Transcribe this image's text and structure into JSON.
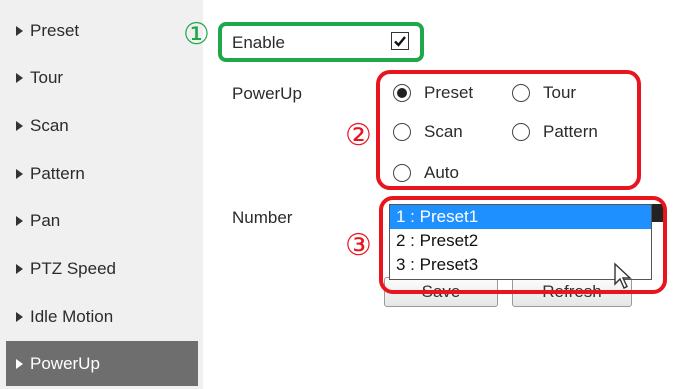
{
  "sidebar": {
    "items": [
      {
        "label": "Preset"
      },
      {
        "label": "Tour"
      },
      {
        "label": "Scan"
      },
      {
        "label": "Pattern"
      },
      {
        "label": "Pan"
      },
      {
        "label": "PTZ Speed"
      },
      {
        "label": "Idle Motion"
      },
      {
        "label": "PowerUp"
      }
    ],
    "active": "PowerUp"
  },
  "form": {
    "enable_label": "Enable",
    "enable_checked": true,
    "powerup_label": "PowerUp",
    "powerup_options": [
      {
        "label": "Preset",
        "selected": true
      },
      {
        "label": "Tour",
        "selected": false
      },
      {
        "label": "Scan",
        "selected": false
      },
      {
        "label": "Pattern",
        "selected": false
      },
      {
        "label": "Auto",
        "selected": false
      }
    ],
    "number_label": "Number",
    "number_options": [
      "1 : Preset1",
      "2 : Preset2",
      "3 : Preset3"
    ],
    "number_selected": "1 : Preset1"
  },
  "buttons": {
    "save": "Save",
    "refresh": "Refresh"
  },
  "callouts": {
    "one": "①",
    "two": "②",
    "three": "③"
  },
  "colors": {
    "green_highlight": "#1fa84b",
    "red_highlight": "#e8141e",
    "active_nav_bg": "#6e6e6e",
    "selected_option_bg": "#1e90ff"
  }
}
